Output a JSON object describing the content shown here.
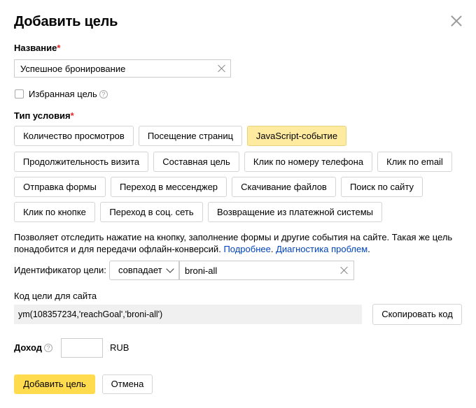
{
  "dialog": {
    "title": "Добавить цель"
  },
  "name_field": {
    "label": "Название",
    "required_mark": "*",
    "value": "Успешное бронирование"
  },
  "favorite": {
    "label": "Избранная цель",
    "checked": false
  },
  "condition_type": {
    "label": "Тип условия",
    "required_mark": "*",
    "options": [
      "Количество просмотров",
      "Посещение страниц",
      "JavaScript-событие",
      "Продолжительность визита",
      "Составная цель",
      "Клик по номеру телефона",
      "Клик по email",
      "Отправка формы",
      "Переход в мессенджер",
      "Скачивание файлов",
      "Поиск по сайту",
      "Клик по кнопке",
      "Переход в соц. сеть",
      "Возвращение из платежной системы"
    ],
    "selected": "JavaScript-событие"
  },
  "description": {
    "text": "Позволяет отследить нажатие на кнопку, заполнение формы и другие события на сайте. Такая же цель понадобится и для передачи офлайн-конверсий.",
    "link_more": "Подробнее",
    "link_diagnostics": "Диагностика проблем"
  },
  "identifier": {
    "label": "Идентификатор цели:",
    "match_mode": "совпадает",
    "value": "broni-all"
  },
  "site_code": {
    "label": "Код цели для сайта",
    "code": "ym(108357234,'reachGoal','broni-all')",
    "copy_label": "Скопировать код"
  },
  "income": {
    "label": "Доход",
    "value": "",
    "currency": "RUB"
  },
  "actions": {
    "submit_label": "Добавить цель",
    "cancel_label": "Отмена"
  },
  "colors": {
    "accent": "#ffdb4d",
    "selected_chip": "#ffeba0",
    "link": "#0044bb",
    "required": "#e62626"
  }
}
